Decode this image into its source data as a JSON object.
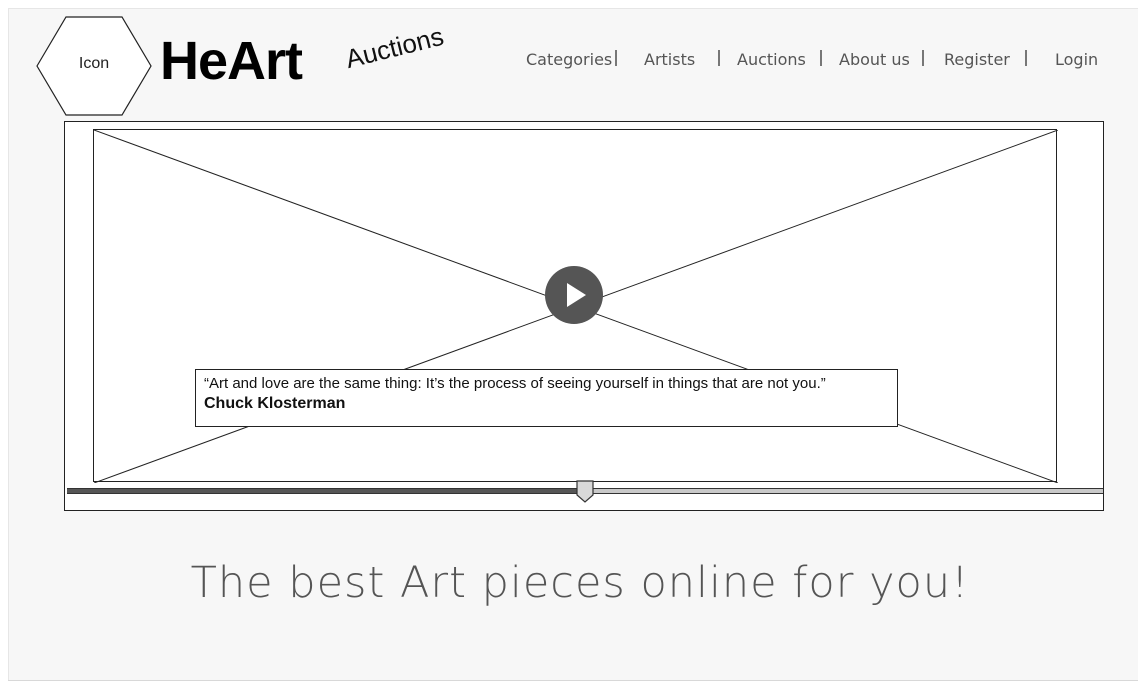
{
  "logo": {
    "icon_label": "Icon",
    "brand": "HeArt",
    "tagline": "Auctions"
  },
  "nav": {
    "items": [
      {
        "label": "Categories"
      },
      {
        "label": "Artists"
      },
      {
        "label": "Auctions"
      },
      {
        "label": "About us"
      },
      {
        "label": "Register"
      },
      {
        "label": "Login"
      }
    ]
  },
  "video": {
    "placeholder_icon": "play-icon",
    "quote": {
      "text": "“Art and love are the same thing: It’s the process of seeing yourself in things that are not you.”",
      "author": "Chuck Klosterman"
    },
    "progress": 0.5
  },
  "hero": {
    "heading": "The best Art pieces online for you!"
  }
}
